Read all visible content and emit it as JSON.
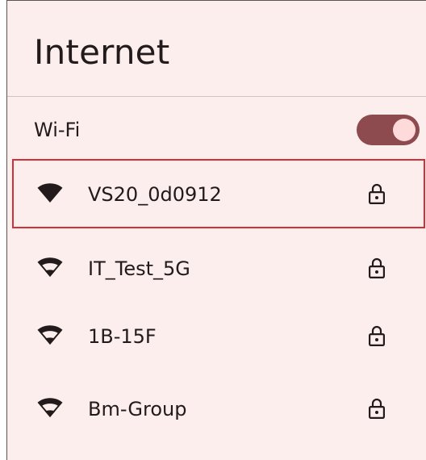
{
  "page": {
    "title": "Internet"
  },
  "wifi": {
    "label": "Wi-Fi",
    "enabled": true
  },
  "networks": [
    {
      "ssid": "VS20_0d0912",
      "icon": "wifi-signal-full-icon",
      "secured": true,
      "selected": true
    },
    {
      "ssid": "IT_Test_5G",
      "icon": "wifi-signal-icon",
      "secured": true,
      "selected": false
    },
    {
      "ssid": "1B-15F",
      "icon": "wifi-signal-icon",
      "secured": true,
      "selected": false
    },
    {
      "ssid": "Bm-Group",
      "icon": "wifi-signal-icon",
      "secured": true,
      "selected": false
    }
  ],
  "colors": {
    "background": "#fbeeed",
    "accent": "#8d4a4f",
    "text": "#231a1b",
    "highlight": "#d22f38"
  }
}
